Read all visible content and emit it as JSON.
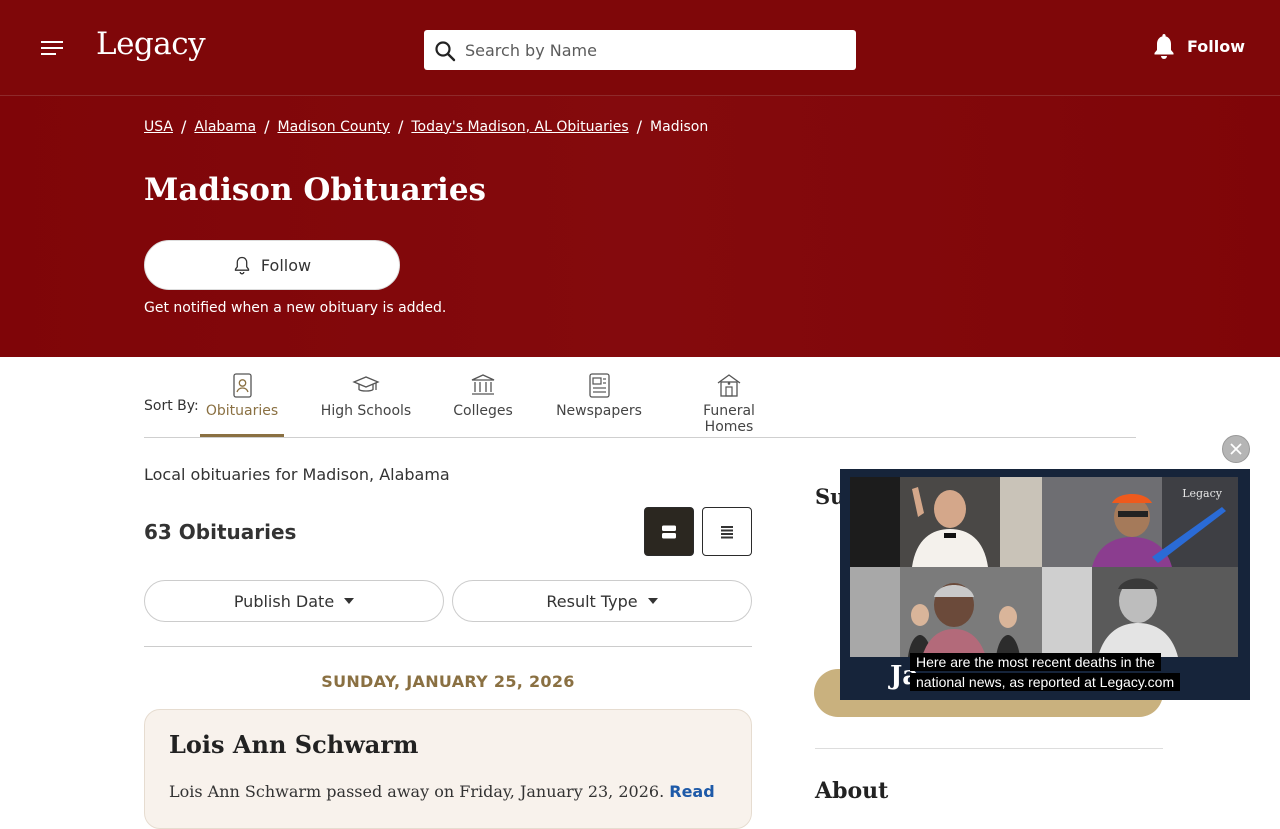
{
  "header": {
    "logo": "Legacy",
    "search_placeholder": "Search by Name",
    "follow_label": "Follow"
  },
  "hero": {
    "breadcrumbs": [
      "USA",
      "Alabama",
      "Madison County",
      "Today's Madison, AL Obituaries",
      "Madison"
    ],
    "title": "Madison Obituaries",
    "follow_label": "Follow",
    "notify_text": "Get notified when a new obituary is added."
  },
  "sort": {
    "label": "Sort By:",
    "tabs": [
      {
        "label": "Obituaries",
        "icon": "obituary-icon",
        "active": true
      },
      {
        "label": "High Schools",
        "icon": "graduation-cap-icon",
        "active": false
      },
      {
        "label": "Colleges",
        "icon": "college-icon",
        "active": false
      },
      {
        "label": "Newspapers",
        "icon": "newspaper-icon",
        "active": false
      },
      {
        "label": "Funeral Homes",
        "icon": "funeral-home-icon",
        "active": false
      }
    ]
  },
  "main": {
    "local_text": "Local obituaries for Madison, Alabama",
    "count_text": "63 Obituaries",
    "filters": [
      "Publish Date",
      "Result Type"
    ],
    "date_heading": "SUNDAY, JANUARY 25, 2026",
    "obituary": {
      "name": "Lois Ann Schwarm",
      "summary": "Lois Ann Schwarm passed away on Friday, January 23, 2026.",
      "read_more": "Read"
    }
  },
  "sidebar": {
    "title_partial": "Su",
    "about_title": "About"
  },
  "video": {
    "watermark": "Legacy",
    "caption_line1": "Here are the most recent deaths in the",
    "caption_line2": "national news, as reported at Legacy.com",
    "overlay_text": "Ja"
  },
  "colors": {
    "brand_red": "#7f0709",
    "gold": "#8a7042",
    "card_bg": "#f8f2ec"
  }
}
